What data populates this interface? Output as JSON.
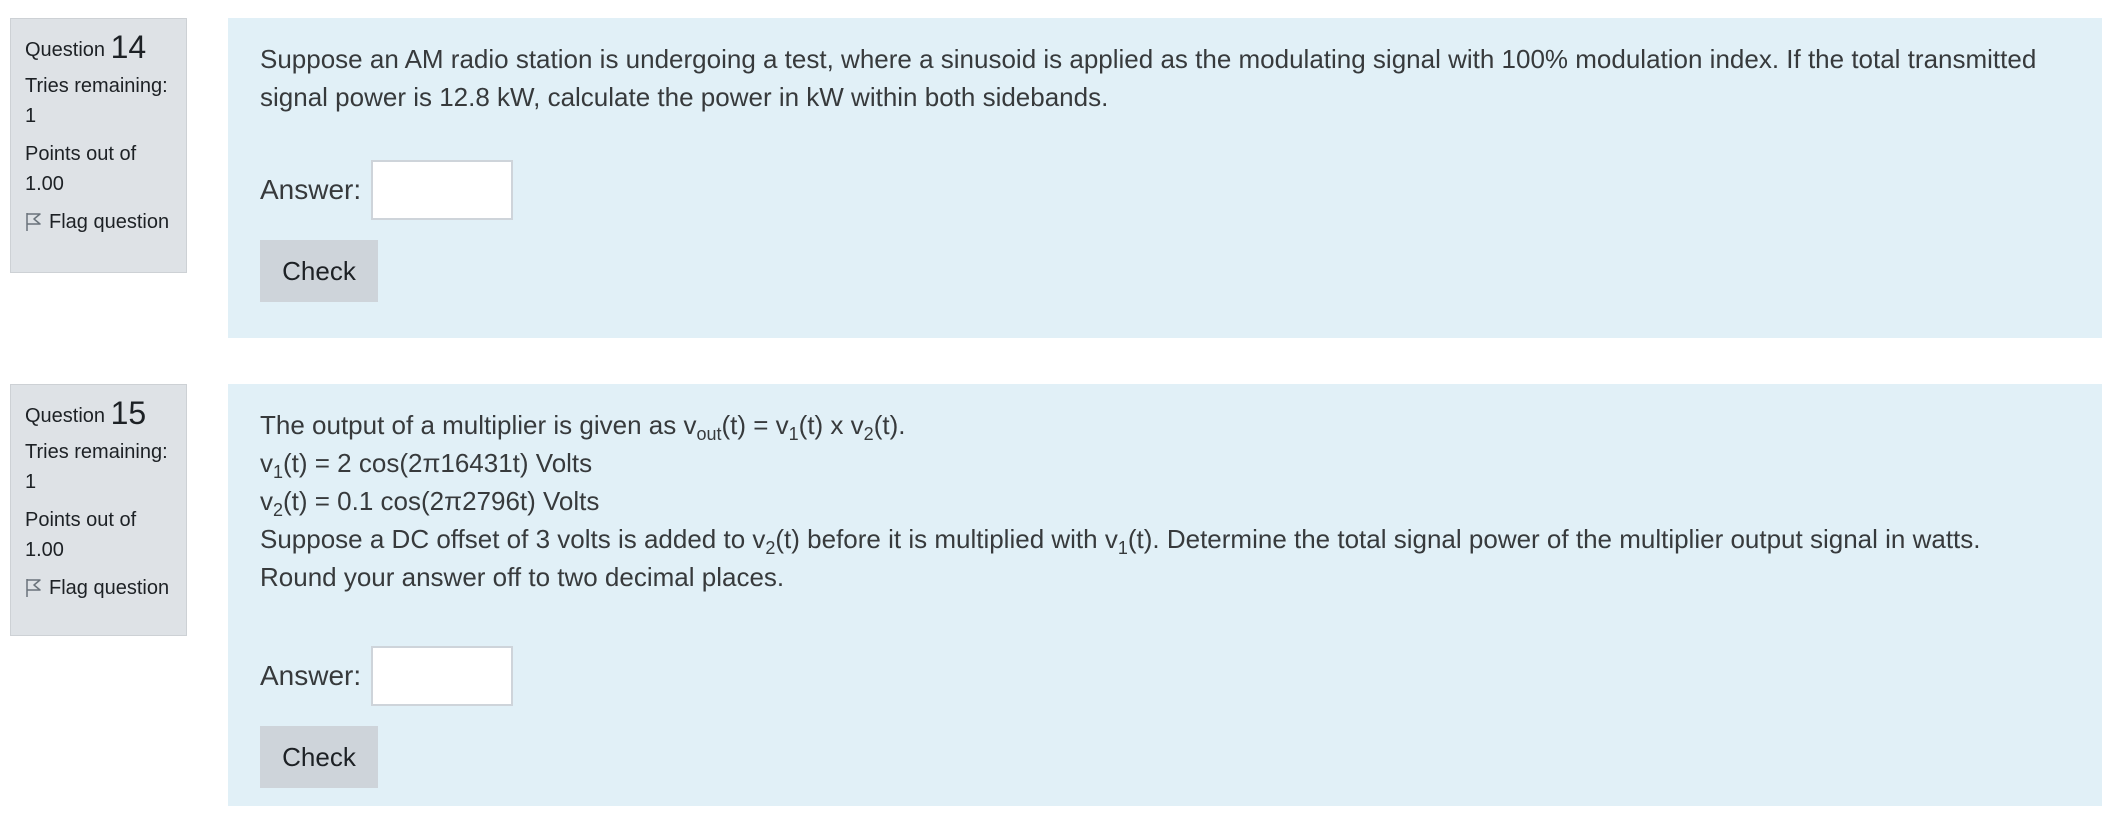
{
  "colors": {
    "info_background": "#dee2e6",
    "content_background": "#e1f0f7",
    "button_background": "#ced4da"
  },
  "questions": [
    {
      "label": "Question",
      "number": "14",
      "tries_label": "Tries remaining:",
      "tries_value": "1",
      "points_label": "Points out of",
      "points_value": "1.00",
      "flag_label": "Flag question",
      "flag_icon": "flag-icon",
      "text_lines": [
        "Suppose an AM radio station is undergoing a test, where a sinusoid is applied as the modulating signal with 100% modulation index. If the total transmitted",
        "signal power is 12.8 kW, calculate the power in kW within both sidebands."
      ],
      "answer_label": "Answer:",
      "answer_value": "",
      "check_label": "Check"
    },
    {
      "label": "Question",
      "number": "15",
      "tries_label": "Tries remaining:",
      "tries_value": "1",
      "points_label": "Points out of",
      "points_value": "1.00",
      "flag_label": "Flag question",
      "flag_icon": "flag-icon",
      "text": {
        "line1_pre": "The output of a multiplier is given as v",
        "line1_sub_out": "out",
        "line1_mid1": "(t) = v",
        "line1_sub_1": "1",
        "line1_mid2": "(t) x v",
        "line1_sub_2": "2",
        "line1_post": "(t).",
        "line2_pre": "v",
        "line2_sub": "1",
        "line2_post": "(t) = 2 cos(2π16431t) Volts",
        "line3_pre": "v",
        "line3_sub": "2",
        "line3_post": "(t) = 0.1 cos(2π2796t) Volts",
        "line4_pre": "Suppose a DC offset of 3 volts is added to v",
        "line4_sub_2": "2",
        "line4_mid": "(t) before it is multiplied with v",
        "line4_sub_1": "1",
        "line4_post": "(t). Determine the total signal power of the multiplier output signal in watts.",
        "line5": "Round your answer off to two decimal places."
      },
      "answer_label": "Answer:",
      "answer_value": "",
      "check_label": "Check"
    }
  ]
}
